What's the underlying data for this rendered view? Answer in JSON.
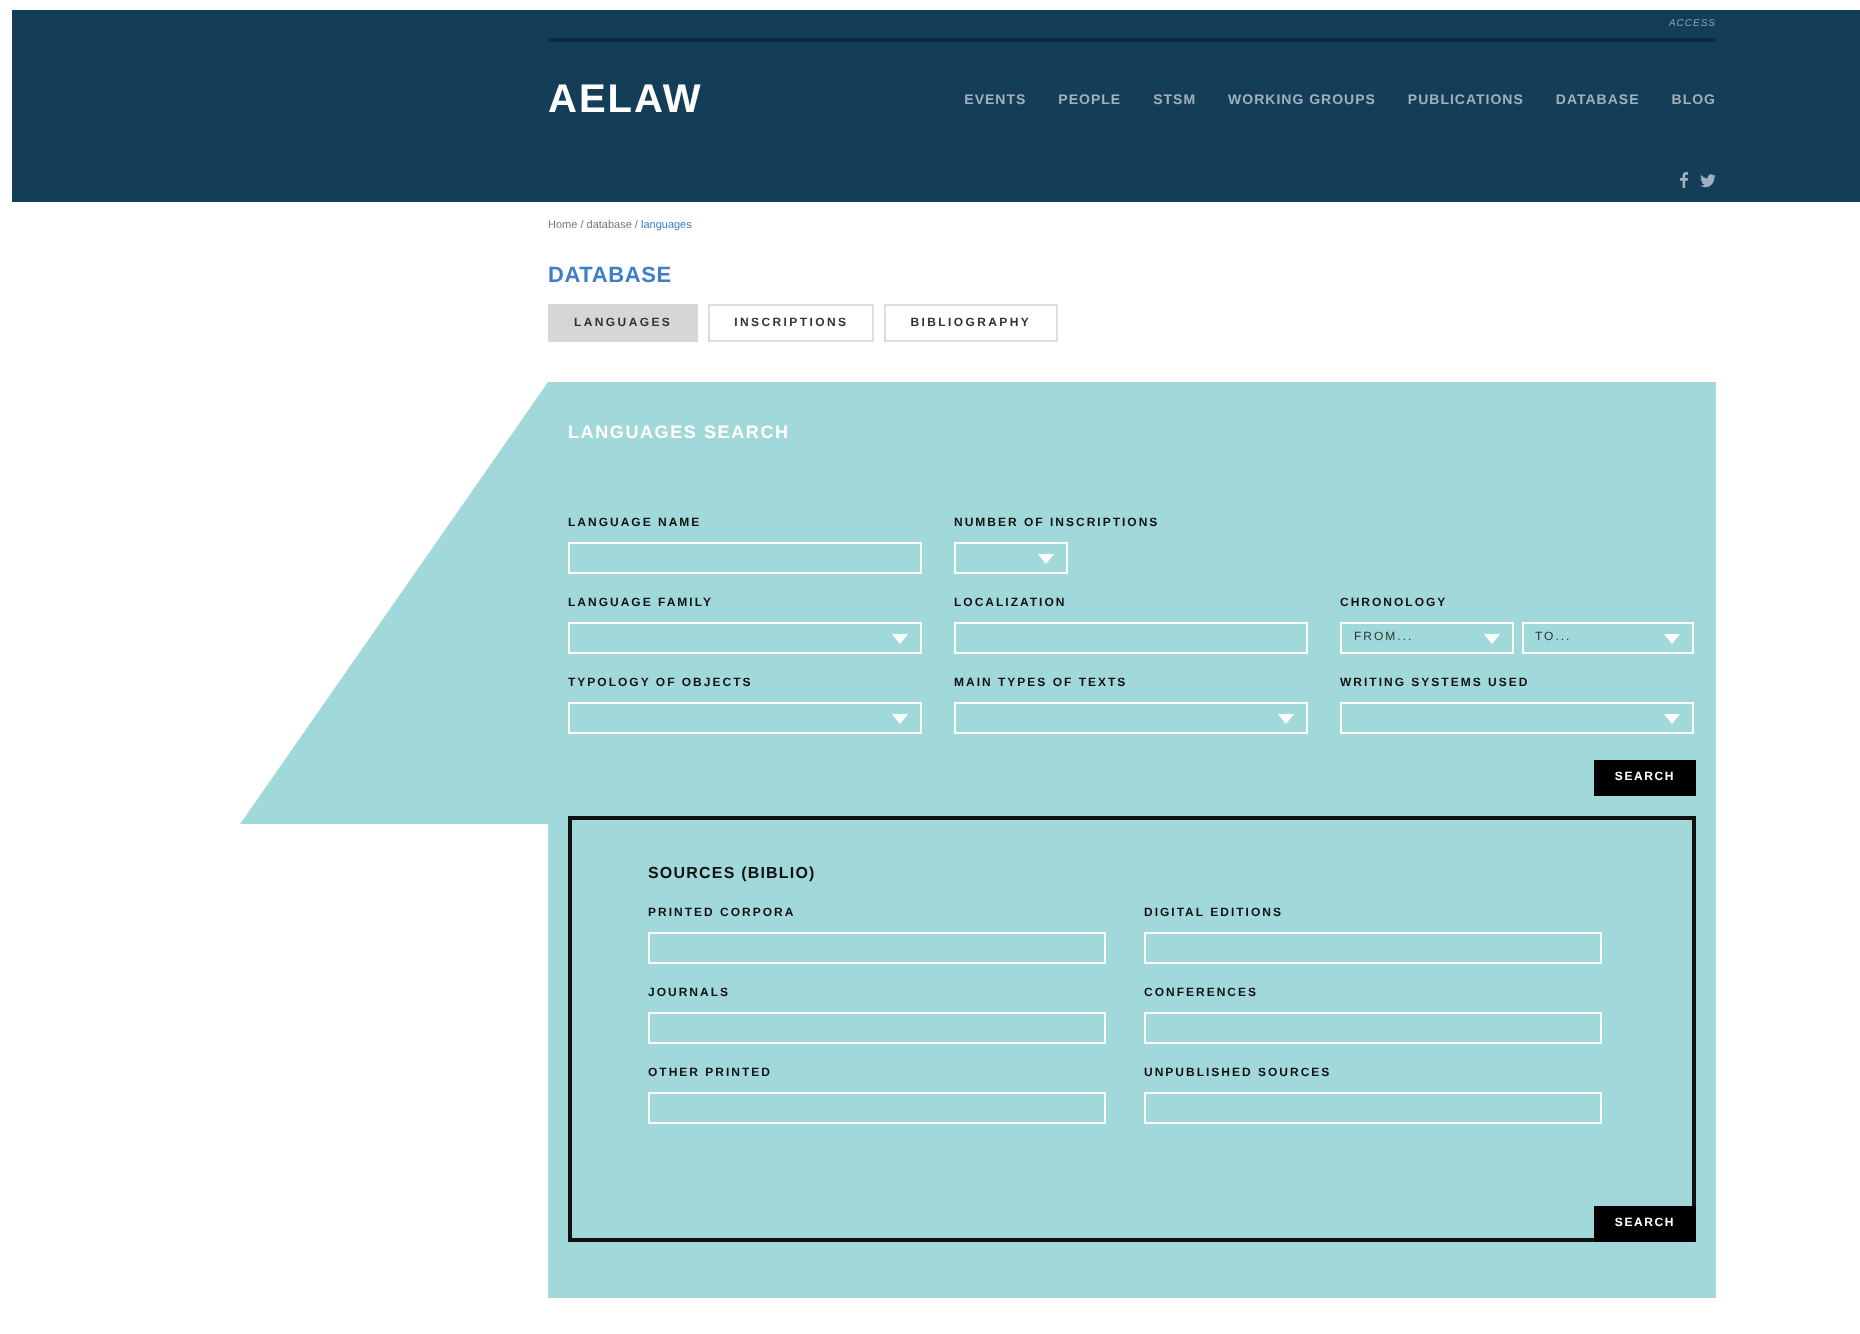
{
  "header": {
    "access": "ACCESS",
    "logo": "AELAW",
    "nav": [
      {
        "label": "EVENTS"
      },
      {
        "label": "PEOPLE"
      },
      {
        "label": "STSM"
      },
      {
        "label": "WORKING GROUPS"
      },
      {
        "label": "PUBLICATIONS"
      },
      {
        "label": "DATABASE"
      },
      {
        "label": "BLOG"
      }
    ]
  },
  "breadcrumb": {
    "path": "Home / database / ",
    "current": "languages"
  },
  "title": "DATABASE",
  "tabs": [
    {
      "label": "LANGUAGES",
      "selected": true
    },
    {
      "label": "INSCRIPTIONS",
      "selected": false
    },
    {
      "label": "BIBLIOGRAPHY",
      "selected": false
    }
  ],
  "search": {
    "title": "LANGUAGES SEARCH",
    "rows": [
      [
        {
          "label": "LANGUAGE NAME",
          "kind": "text"
        },
        {
          "label": "NUMBER OF INSCRIPTIONS",
          "kind": "short_select"
        }
      ],
      [
        {
          "label": "LANGUAGE FAMILY",
          "kind": "select"
        },
        {
          "label": "LOCALIZATION",
          "kind": "text"
        },
        {
          "label": "CHRONOLOGY",
          "kind": "range",
          "from": "FROM...",
          "to": "TO..."
        }
      ],
      [
        {
          "label": "TYPOLOGY OF OBJECTS",
          "kind": "select"
        },
        {
          "label": "MAIN TYPES OF TEXTS",
          "kind": "select"
        },
        {
          "label": "WRITING SYSTEMS USED",
          "kind": "select"
        }
      ]
    ],
    "button": "SEARCH"
  },
  "sources": {
    "title": "SOURCES (BIBLIO)",
    "fields": [
      {
        "label": "PRINTED CORPORA"
      },
      {
        "label": "DIGITAL EDITIONS"
      },
      {
        "label": "JOURNALS"
      },
      {
        "label": "CONFERENCES"
      },
      {
        "label": "OTHER PRINTED"
      },
      {
        "label": "UNPUBLISHED SOURCES"
      }
    ],
    "button": "SEARCH"
  }
}
